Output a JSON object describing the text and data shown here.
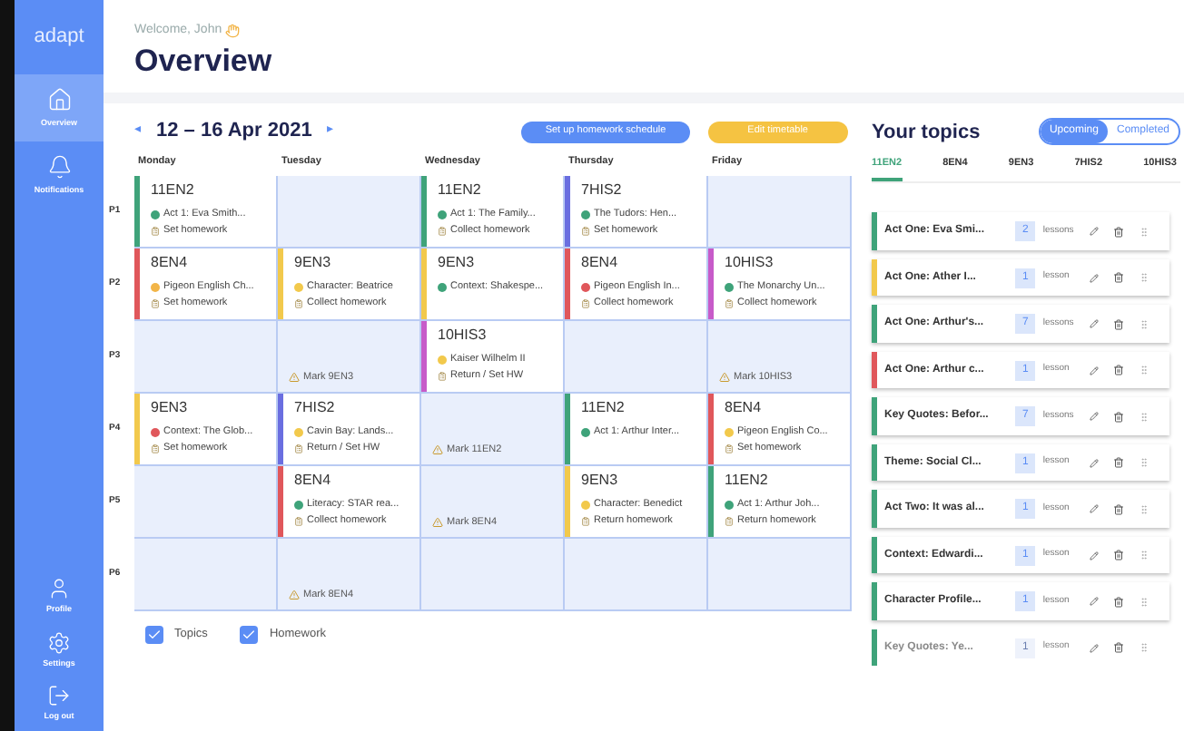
{
  "sidebar": {
    "logo": "adapt",
    "items": [
      {
        "label": "Overview",
        "selected": true
      },
      {
        "label": "Notifications",
        "selected": false
      }
    ],
    "bottom_items": [
      {
        "label": "Profile"
      },
      {
        "label": "Settings"
      },
      {
        "label": "Log out"
      }
    ]
  },
  "header": {
    "welcome": "Welcome, John",
    "title": "Overview"
  },
  "week": {
    "label": "12 – 16 Apr 2021",
    "prev": "◂",
    "next": "▸"
  },
  "buttons": [
    {
      "label": "Set up homework schedule",
      "kind": "primary"
    },
    {
      "label": "Edit timetable",
      "kind": "secondary"
    }
  ],
  "days": [
    "Monday",
    "Tuesday",
    "Wednesday",
    "Thursday",
    "Friday"
  ],
  "periods": [
    {
      "label": "P1",
      "cells": [
        {
          "kind": "lesson",
          "class": "11EN2",
          "color": "#3fa37a",
          "topic": {
            "text": "Act 1: Eva Smith...",
            "color": "#3fa37a"
          },
          "task": "Set homework"
        },
        {
          "kind": "empty"
        },
        {
          "kind": "lesson",
          "class": "11EN2",
          "color": "#3fa37a",
          "topic": {
            "text": "Act 1: The Family...",
            "color": "#3fa37a"
          },
          "task": "Collect homework"
        },
        {
          "kind": "lesson",
          "class": "7HIS2",
          "color": "#6a6ee0",
          "topic": {
            "text": "The Tudors: Hen...",
            "color": "#3fa37a"
          },
          "task": "Set homework"
        },
        {
          "kind": "empty"
        }
      ]
    },
    {
      "label": "P2",
      "cells": [
        {
          "kind": "lesson",
          "class": "8EN4",
          "color": "#e0575b",
          "topic": {
            "text": "Pigeon English Ch...",
            "color": "#f2b548"
          },
          "task": "Set homework"
        },
        {
          "kind": "lesson",
          "class": "9EN3",
          "color": "#f2c94c",
          "topic": {
            "text": "Character: Beatrice",
            "color": "#f2c94c"
          },
          "task": "Collect homework"
        },
        {
          "kind": "lesson",
          "class": "9EN3",
          "color": "#f2c94c",
          "topic": {
            "text": "Context: Shakespe...",
            "color": "#3fa37a"
          }
        },
        {
          "kind": "lesson",
          "class": "8EN4",
          "color": "#e0575b",
          "topic": {
            "text": "Pigeon English In...",
            "color": "#e0575b"
          },
          "task": "Collect homework"
        },
        {
          "kind": "lesson",
          "class": "10HIS3",
          "color": "#c75bc9",
          "topic": {
            "text": "The Monarchy Un...",
            "color": "#3fa37a"
          },
          "task": "Collect homework"
        }
      ]
    },
    {
      "label": "P3",
      "cells": [
        {
          "kind": "empty"
        },
        {
          "kind": "empty",
          "mark": "Mark 9EN3"
        },
        {
          "kind": "lesson",
          "class": "10HIS3",
          "color": "#c75bc9",
          "topic": {
            "text": "Kaiser Wilhelm II",
            "color": "#f2c94c"
          },
          "task": "Return / Set HW"
        },
        {
          "kind": "empty"
        },
        {
          "kind": "empty",
          "mark": "Mark 10HIS3"
        }
      ]
    },
    {
      "label": "P4",
      "cells": [
        {
          "kind": "lesson",
          "class": "9EN3",
          "color": "#f2c94c",
          "topic": {
            "text": "Context: The Glob...",
            "color": "#e0575b"
          },
          "task": "Set homework"
        },
        {
          "kind": "lesson",
          "class": "7HIS2",
          "color": "#6a6ee0",
          "topic": {
            "text": "Cavin Bay: Lands...",
            "color": "#f2c94c"
          },
          "task": "Return / Set HW"
        },
        {
          "kind": "empty",
          "mark": "Mark 11EN2"
        },
        {
          "kind": "lesson",
          "class": "11EN2",
          "color": "#3fa37a",
          "topic": {
            "text": "Act 1: Arthur Inter...",
            "color": "#3fa37a"
          }
        },
        {
          "kind": "lesson",
          "class": "8EN4",
          "color": "#e0575b",
          "topic": {
            "text": "Pigeon English Co...",
            "color": "#f2c94c"
          },
          "task": "Set homework"
        }
      ]
    },
    {
      "label": "P5",
      "cells": [
        {
          "kind": "empty"
        },
        {
          "kind": "lesson",
          "class": "8EN4",
          "color": "#e0575b",
          "topic": {
            "text": "Literacy: STAR rea...",
            "color": "#3fa37a"
          },
          "task": "Collect homework"
        },
        {
          "kind": "empty",
          "mark": "Mark 8EN4"
        },
        {
          "kind": "lesson",
          "class": "9EN3",
          "color": "#f2c94c",
          "topic": {
            "text": "Character: Benedict",
            "color": "#f2c94c"
          },
          "task": "Return homework"
        },
        {
          "kind": "lesson",
          "class": "11EN2",
          "color": "#3fa37a",
          "topic": {
            "text": "Act 1: Arthur Joh...",
            "color": "#3fa37a"
          },
          "task": "Return homework"
        }
      ]
    },
    {
      "label": "P6",
      "cells": [
        {
          "kind": "empty"
        },
        {
          "kind": "empty",
          "mark": "Mark 8EN4"
        },
        {
          "kind": "empty"
        },
        {
          "kind": "empty"
        },
        {
          "kind": "empty"
        }
      ]
    }
  ],
  "filters": [
    {
      "label": "Topics",
      "checked": true
    },
    {
      "label": "Homework",
      "checked": true
    }
  ],
  "topics": {
    "title": "Your topics",
    "toggle": [
      {
        "label": "Upcoming",
        "selected": true
      },
      {
        "label": "Completed",
        "selected": false
      }
    ],
    "tabs": [
      {
        "label": "11EN2",
        "selected": true
      },
      {
        "label": "8EN4",
        "selected": false
      },
      {
        "label": "9EN3",
        "selected": false
      },
      {
        "label": "7HIS2",
        "selected": false
      },
      {
        "label": "10HIS3",
        "selected": false
      }
    ],
    "items": [
      {
        "title": "Act One: Eva Smi...",
        "count": "2",
        "unit": "lessons",
        "color": "#3fa37a",
        "faded": false
      },
      {
        "title": "Act One: Ather I...",
        "count": "1",
        "unit": "lesson",
        "color": "#f2c94c",
        "faded": false
      },
      {
        "title": "Act One: Arthur's...",
        "count": "7",
        "unit": "lessons",
        "color": "#3fa37a",
        "faded": false
      },
      {
        "title": "Act One: Arthur c...",
        "count": "1",
        "unit": "lesson",
        "color": "#e0575b",
        "faded": false
      },
      {
        "title": "Key Quotes: Befor...",
        "count": "7",
        "unit": "lessons",
        "color": "#3fa37a",
        "faded": false
      },
      {
        "title": "Theme: Social Cl...",
        "count": "1",
        "unit": "lesson",
        "color": "#3fa37a",
        "faded": false
      },
      {
        "title": "Act Two: It was al...",
        "count": "1",
        "unit": "lesson",
        "color": "#3fa37a",
        "faded": false
      },
      {
        "title": "Context: Edwardi...",
        "count": "1",
        "unit": "lesson",
        "color": "#3fa37a",
        "faded": false
      },
      {
        "title": "Character Profile...",
        "count": "1",
        "unit": "lesson",
        "color": "#3fa37a",
        "faded": false
      },
      {
        "title": "Key Quotes: Ye...",
        "count": "1",
        "unit": "lesson",
        "color": "#3fa37a",
        "faded": true
      }
    ]
  }
}
